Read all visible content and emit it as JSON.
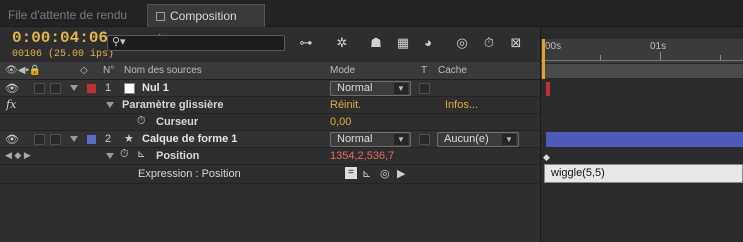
{
  "tabs": [
    {
      "label": "File d'attente de rendu",
      "active": false
    },
    {
      "label": "Composition 1",
      "active": true
    }
  ],
  "timecode": "0:00:04:06",
  "frame_info": "00106 (25.00 ips)",
  "search": {
    "placeholder": "",
    "icon": "search-icon"
  },
  "columns": {
    "number": "N°",
    "source_name": "Nom des sources",
    "mode": "Mode",
    "t": "T",
    "matte": "Cache"
  },
  "ruler": {
    "labels": [
      "00s",
      "01s"
    ]
  },
  "layers": [
    {
      "index": "1",
      "name": "Nul 1",
      "color": "#c0302f",
      "mode": "Normal",
      "effect": {
        "name": "Paramètre glissière",
        "reset": "Réinit.",
        "info": "Infos...",
        "param_name": "Curseur",
        "param_value": "0,00"
      }
    },
    {
      "index": "2",
      "name": "Calque de forme 1",
      "color": "#5a6fc8",
      "mode": "Normal",
      "matte": "Aucun(e)",
      "property": {
        "name": "Position",
        "value": "1354,2,536,7",
        "expression_label": "Expression : Position",
        "expression_text": "wiggle(5,5)"
      }
    }
  ],
  "accent": "#e2b44a"
}
